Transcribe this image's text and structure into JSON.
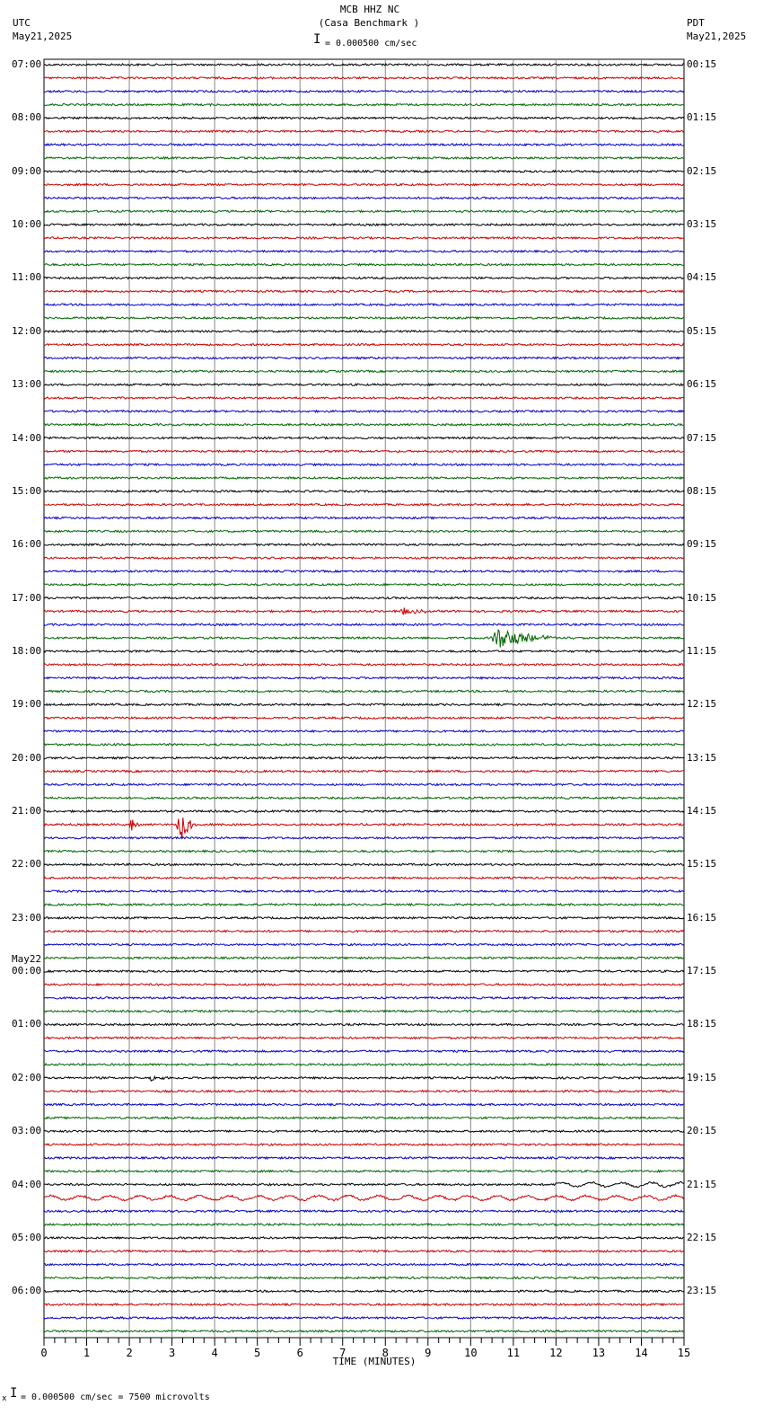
{
  "header": {
    "title": "MCB HHZ NC",
    "subtitle": "(Casa Benchmark )",
    "left_tz": "UTC",
    "left_date": "May21,2025",
    "right_tz": "PDT",
    "right_date": "May21,2025",
    "scale_text": "= 0.000500 cm/sec"
  },
  "footer": {
    "scale_text": "= 0.000500 cm/sec =    7500 microvolts",
    "mark": "x"
  },
  "chart_data": {
    "type": "line",
    "subtype": "helicorder",
    "title": "MCB HHZ NC (Casa Benchmark )",
    "xlabel": "TIME (MINUTES)",
    "xlim": [
      0,
      15
    ],
    "xticks": [
      "0",
      "1",
      "2",
      "3",
      "4",
      "5",
      "6",
      "7",
      "8",
      "9",
      "10",
      "11",
      "12",
      "13",
      "14",
      "15"
    ],
    "rows_per_hour": 4,
    "row_minutes": 15,
    "trace_colors": [
      "#000000",
      "#cc0000",
      "#0000cc",
      "#006600"
    ],
    "left_labels": [
      "07:00",
      "08:00",
      "09:00",
      "10:00",
      "11:00",
      "12:00",
      "13:00",
      "14:00",
      "15:00",
      "16:00",
      "17:00",
      "18:00",
      "19:00",
      "20:00",
      "21:00",
      "22:00",
      "23:00",
      "00:00",
      "01:00",
      "02:00",
      "03:00",
      "04:00",
      "05:00",
      "06:00"
    ],
    "date_change_label": "May22",
    "right_labels": [
      "00:15",
      "01:15",
      "02:15",
      "03:15",
      "04:15",
      "05:15",
      "06:15",
      "07:15",
      "08:15",
      "09:15",
      "10:15",
      "11:15",
      "12:15",
      "13:15",
      "14:15",
      "15:15",
      "16:15",
      "17:15",
      "18:15",
      "19:15",
      "20:15",
      "21:15",
      "22:15",
      "23:15"
    ],
    "events": [
      {
        "row": 41,
        "start_min": 8.2,
        "end_min": 9.6,
        "amplitude": 0.25
      },
      {
        "row": 43,
        "start_min": 10.4,
        "end_min": 12.6,
        "amplitude": 0.9
      },
      {
        "row": 57,
        "start_min": 2.0,
        "end_min": 2.3,
        "amplitude": 0.6
      },
      {
        "row": 57,
        "start_min": 3.1,
        "end_min": 3.8,
        "amplitude": 1.3
      },
      {
        "row": 76,
        "start_min": 2.4,
        "end_min": 3.2,
        "amplitude": 0.2
      },
      {
        "row": 84,
        "start_min": 12.0,
        "end_min": 15.0,
        "amplitude": 0.35,
        "long_period": true
      },
      {
        "row": 85,
        "start_min": 0.0,
        "end_min": 15.0,
        "amplitude": 0.35,
        "long_period": true
      }
    ]
  }
}
